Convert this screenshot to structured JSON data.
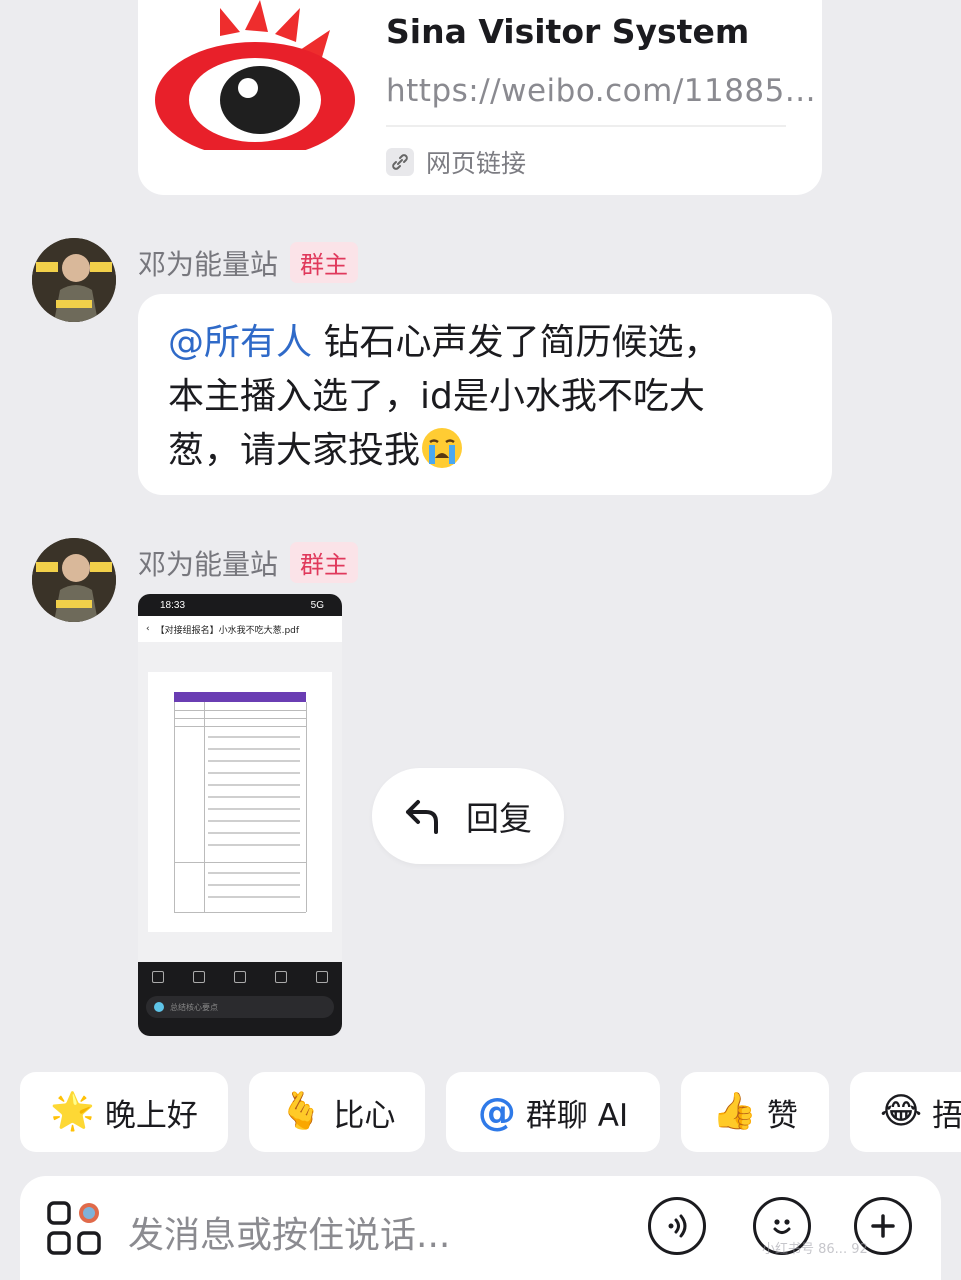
{
  "link_card": {
    "title": "Sina Visitor System",
    "url": "https://weibo.com/11885...",
    "type_label": "网页链接"
  },
  "messages": [
    {
      "sender": "邓为能量站",
      "badge": "群主",
      "mention": "@所有人",
      "line1": " 钻石心声发了简历候选，",
      "line2": "本主播入选了，id是小水我不吃大",
      "line3": "葱，请大家投我",
      "emoji": "loudly-crying-face"
    },
    {
      "sender": "邓为能量站",
      "badge": "群主",
      "image": {
        "status_time": "18:33",
        "status_net": "5G",
        "doc_name": "【对接组报名】小水我不吃大葱.pdf",
        "input_hint": "总结核心要点"
      }
    }
  ],
  "reply_popover": {
    "label": "回复",
    "icon": "reply-arrow-icon"
  },
  "quick_replies": [
    {
      "emoji": "🌟",
      "label": "晚上好"
    },
    {
      "emoji": "🫰",
      "label": "比心"
    },
    {
      "emoji": "@",
      "label": "群聊 AI"
    },
    {
      "emoji": "👍",
      "label": "赞"
    },
    {
      "emoji": "😂",
      "label": "捂"
    }
  ],
  "input_bar": {
    "placeholder": "发消息或按住说话..."
  },
  "watermark": "小红书号 86... 92",
  "colors": {
    "background": "#ececef",
    "mention": "#2f6ac8",
    "badge_text": "#e0395c",
    "badge_bg": "#fbe3e8"
  }
}
